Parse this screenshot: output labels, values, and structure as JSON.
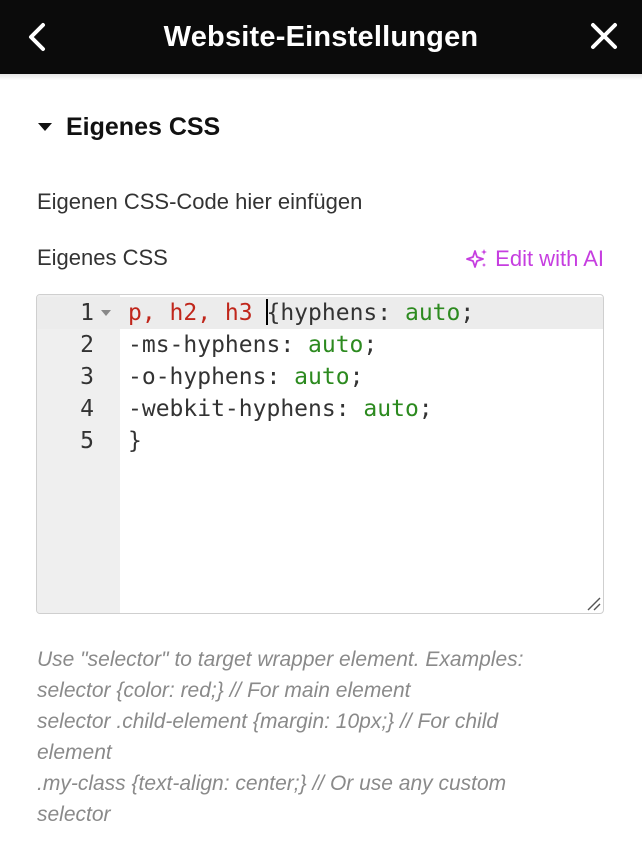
{
  "header": {
    "title": "Website-Einstellungen",
    "back_icon": "chevron-left-icon",
    "close_icon": "close-icon"
  },
  "section": {
    "title": "Eigenes CSS",
    "expanded": true
  },
  "description": "Eigenen CSS-Code hier einfügen",
  "field": {
    "label": "Eigenes CSS",
    "ai_button_label": "Edit with AI",
    "ai_color": "#c63ee0"
  },
  "editor": {
    "lines": [
      {
        "num": "1",
        "selectors": "p, h2, h3",
        "rest_before": "{hyphens: ",
        "value": "auto",
        "rest_after": ";"
      },
      {
        "num": "2",
        "prop": "-ms-hyphens: ",
        "value": "auto",
        "after": ";"
      },
      {
        "num": "3",
        "prop": "-o-hyphens: ",
        "value": "auto",
        "after": ";"
      },
      {
        "num": "4",
        "prop": "-webkit-hyphens: ",
        "value": "auto",
        "after": ";"
      },
      {
        "num": "5",
        "prop": "}",
        "value": "",
        "after": ""
      }
    ]
  },
  "help": [
    "Use \"selector\" to target wrapper element. Examples:",
    "selector {color: red;} // For main element",
    "selector .child-element {margin: 10px;} // For child element",
    ".my-class {text-align: center;} // Or use any custom selector"
  ]
}
